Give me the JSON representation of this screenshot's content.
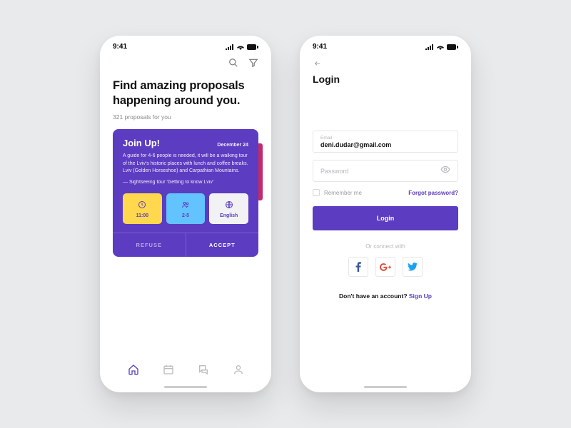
{
  "status": {
    "time": "9:41"
  },
  "colors": {
    "accent": "#5c3cc1"
  },
  "phone1": {
    "headline": "Find amazing proposals happening around you.",
    "subtitle": "321 proposals for you",
    "card": {
      "title": "Join Up!",
      "date": "December 24",
      "body": "A guide for 4-6 people is needed, it will be a walking tour of the Lviv's historic places with lunch and coffee breaks. Lviv (Golden Horseshoe) and Carpathian Mountains.",
      "source": "— Sightseeing tour 'Getting to know Lviv'",
      "chips": {
        "time": "11:00",
        "people": "2-5",
        "lang": "English"
      },
      "refuse": "REFUSE",
      "accept": "ACCEPT"
    }
  },
  "phone2": {
    "title": "Login",
    "email_label": "Email",
    "email_value": "deni.dudar@gmail.com",
    "password_label": "Password",
    "remember": "Remember me",
    "forgot": "Forgot password?",
    "login_btn": "Login",
    "or": "Or connect with",
    "signup_prompt": "Don't have an account?  ",
    "signup_link": "Sign Up"
  }
}
